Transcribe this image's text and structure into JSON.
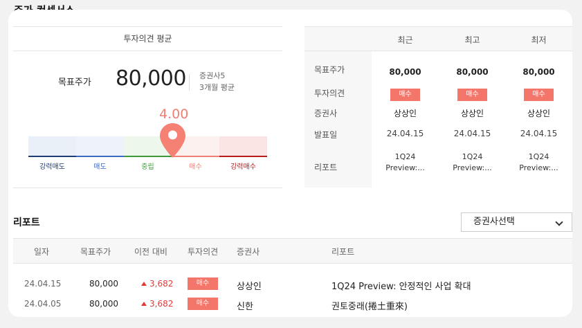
{
  "section_title": "주가 컨센서스",
  "consensus": {
    "header": "투자의견 평균",
    "target_label": "목표주가",
    "target_value": "80,000",
    "meta_brokers": "증권사5",
    "meta_period": "3개월 평균",
    "score": "4.00",
    "scale_labels": [
      "강력매도",
      "매도",
      "중립",
      "매수",
      "강력매수"
    ]
  },
  "summary": {
    "columns": [
      "최근",
      "최고",
      "최저"
    ],
    "row_labels": [
      "목표주가",
      "투자의견",
      "증권사",
      "발표일",
      "리포트"
    ],
    "cols": [
      {
        "target": "80,000",
        "opinion": "매수",
        "broker": "상상인",
        "date": "24.04.15",
        "report1": "1Q24",
        "report2": "Preview:..."
      },
      {
        "target": "80,000",
        "opinion": "매수",
        "broker": "상상인",
        "date": "24.04.15",
        "report1": "1Q24",
        "report2": "Preview:..."
      },
      {
        "target": "80,000",
        "opinion": "매수",
        "broker": "상상인",
        "date": "24.04.15",
        "report1": "1Q24",
        "report2": "Preview:..."
      }
    ]
  },
  "reports": {
    "title": "리포트",
    "select_value": "증권사선택",
    "headers": [
      "일자",
      "목표주가",
      "이전 대비",
      "투자의견",
      "증권사",
      "리포트"
    ],
    "rows": [
      {
        "date": "24.04.15",
        "target": "80,000",
        "change": "3,682",
        "opinion": "매수",
        "broker": "상상인",
        "report": "1Q24 Preview: 안정적인 사업 확대"
      },
      {
        "date": "24.04.05",
        "target": "80,000",
        "change": "3,682",
        "opinion": "매수",
        "broker": "신한",
        "report": "권토중래(捲土重來)"
      }
    ]
  },
  "colors": {
    "accent": "#f4766b",
    "score_color": "#f07e74",
    "up_color": "#e53935"
  },
  "icons": {
    "marker": "map-pin-icon",
    "dropdown": "chevron-down-icon",
    "change": "triangle-up-icon"
  }
}
